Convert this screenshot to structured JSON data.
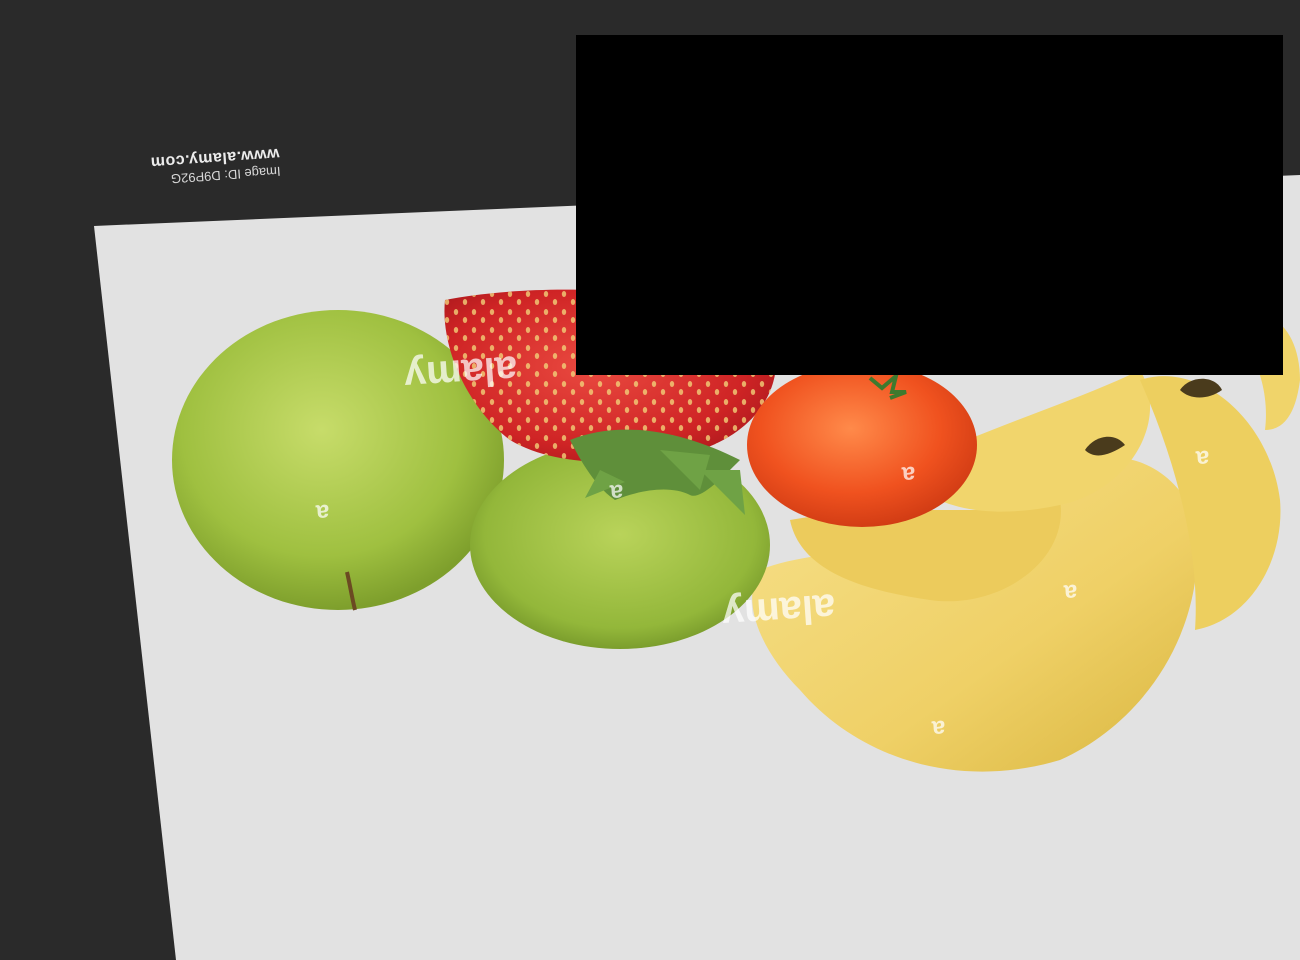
{
  "caption": {
    "site": "www.alamy.com",
    "image_id": "Image ID: D9P92G"
  },
  "watermarks": {
    "brand_a": "alamy",
    "brand_b": "alamy",
    "letter": "a"
  },
  "colors": {
    "background": "#2a2a2a",
    "sheet": "#e2e2e2",
    "apple": "#a9c74a",
    "strawberry": "#d42a28",
    "tomato": "#ee4a1e",
    "banana": "#f0d36a",
    "redaction": "#000000"
  }
}
